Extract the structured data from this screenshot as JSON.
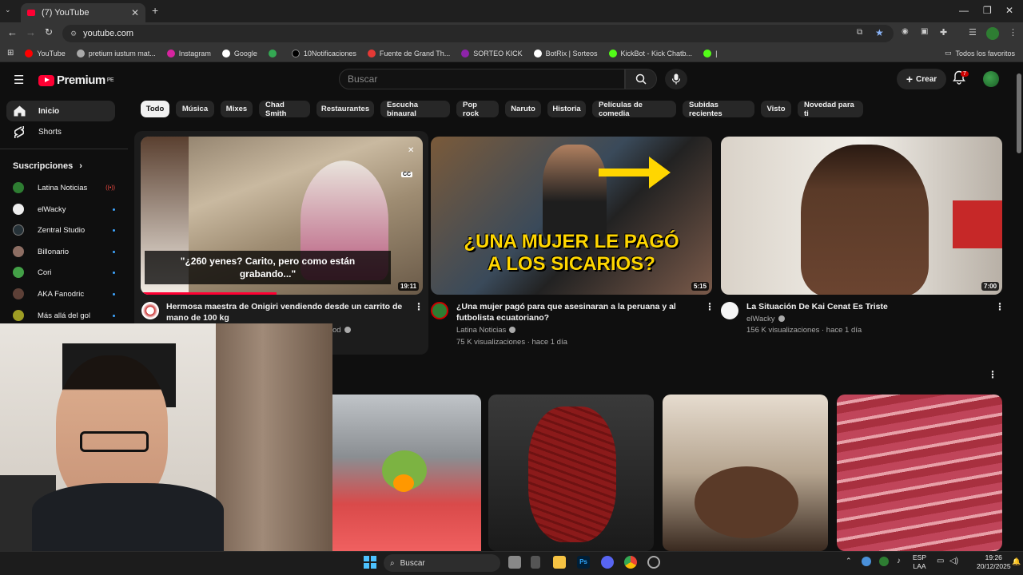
{
  "browser": {
    "tab_title": "(7) YouTube",
    "address": "youtube.com",
    "bookmarks": [
      {
        "label": "YouTube",
        "color": "#ff0000"
      },
      {
        "label": "pretium iustum mat...",
        "color": "#aaaaaa"
      },
      {
        "label": "Instagram",
        "color": "#d6249f"
      },
      {
        "label": "Google",
        "color": "#ffffff"
      },
      {
        "label": "",
        "color": "#34a853"
      },
      {
        "label": "10Notificaciones",
        "color": "#000000"
      },
      {
        "label": "Fuente de Grand Th...",
        "color": "#e53935"
      },
      {
        "label": "SORTEO KICK",
        "color": "#8e24aa"
      },
      {
        "label": "BotRix | Sorteos",
        "color": "#ffffff"
      },
      {
        "label": "KickBot - Kick Chatb...",
        "color": "#53fc18"
      },
      {
        "label": "|",
        "color": "#53fc18"
      }
    ],
    "all_bookmarks": "Todos los favoritos"
  },
  "youtube": {
    "logo_text": "Premium",
    "logo_region": "PE",
    "search_placeholder": "Buscar",
    "create_label": "Crear",
    "notification_count": "7"
  },
  "sidebar": {
    "items": [
      {
        "label": "Inicio",
        "icon": "home-icon",
        "active": true
      },
      {
        "label": "Shorts",
        "icon": "shorts-icon",
        "active": false
      }
    ],
    "subscriptions_label": "Suscripciones",
    "subscriptions": [
      {
        "name": "Latina Noticias",
        "color": "#2e7d32",
        "status": "live"
      },
      {
        "name": "elWacky",
        "color": "#eeeeee",
        "status": "new"
      },
      {
        "name": "Zentral Studio",
        "color": "#263238",
        "status": "new"
      },
      {
        "name": "Billonario",
        "color": "#8d6e63",
        "status": "new"
      },
      {
        "name": "Cori",
        "color": "#43a047",
        "status": "new"
      },
      {
        "name": "AKA Fanodric",
        "color": "#5d4037",
        "status": "new"
      },
      {
        "name": "Más allá del gol",
        "color": "#9e9d24",
        "status": "new"
      }
    ],
    "live_indicator": "((•))"
  },
  "chips": [
    "Todo",
    "Música",
    "Mixes",
    "Chad Smith",
    "Restaurantes",
    "Escucha binaural",
    "Pop rock",
    "Naruto",
    "Historia",
    "Películas de comedia",
    "Subidas recientes",
    "Visto",
    "Novedad para ti"
  ],
  "videos": [
    {
      "title_line1": "Hermosa maestra de Onigiri vendiendo desde un carrito de",
      "title_line2": "mano de 100 kg",
      "channel_partial": "od",
      "duration": "19:11",
      "caption_line1": "\"¿260 yenes? Carito, pero como están",
      "caption_line2": "grabando...\"",
      "cc": "CC"
    },
    {
      "title_line1": "¿Una mujer pagó para que asesinaran a la peruana y al",
      "title_line2": "futbolista ecuatoriano?",
      "channel": "Latina Noticias",
      "meta": "75 K visualizaciones · hace 1 día",
      "duration": "5:15",
      "thumb_text_line1": "¿UNA MUJER LE PAGÓ",
      "thumb_text_line2": "A LOS SICARIOS?"
    },
    {
      "title_line1": "La Situación De Kai Cenat Es Triste",
      "channel": "elWacky",
      "meta": "156 K visualizaciones · hace 1 día",
      "duration": "7:00"
    }
  ],
  "taskbar": {
    "search_label": "Buscar",
    "lang_line1": "ESP",
    "lang_line2": "LAA",
    "time": "19:26",
    "date": "20/12/2025"
  }
}
